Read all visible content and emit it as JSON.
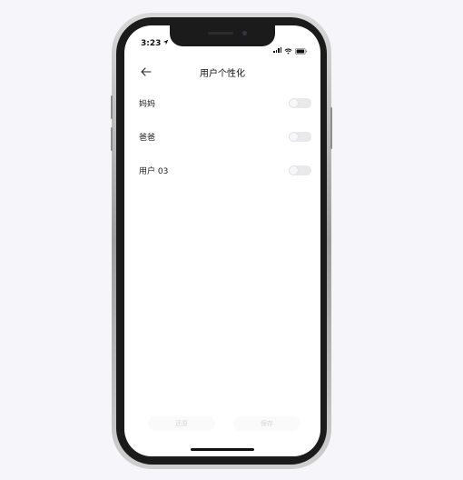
{
  "status_bar": {
    "time": "3:23"
  },
  "header": {
    "title": "用户个性化"
  },
  "users": [
    {
      "label": "妈妈",
      "enabled": false
    },
    {
      "label": "爸爸",
      "enabled": false
    },
    {
      "label": "用户 03",
      "enabled": false
    }
  ],
  "footer": {
    "left_button": "还原",
    "right_button": "保存"
  },
  "colors": {
    "background": "#f6f6fa",
    "toggle_off": "#e9e9ec",
    "text": "#222222"
  }
}
